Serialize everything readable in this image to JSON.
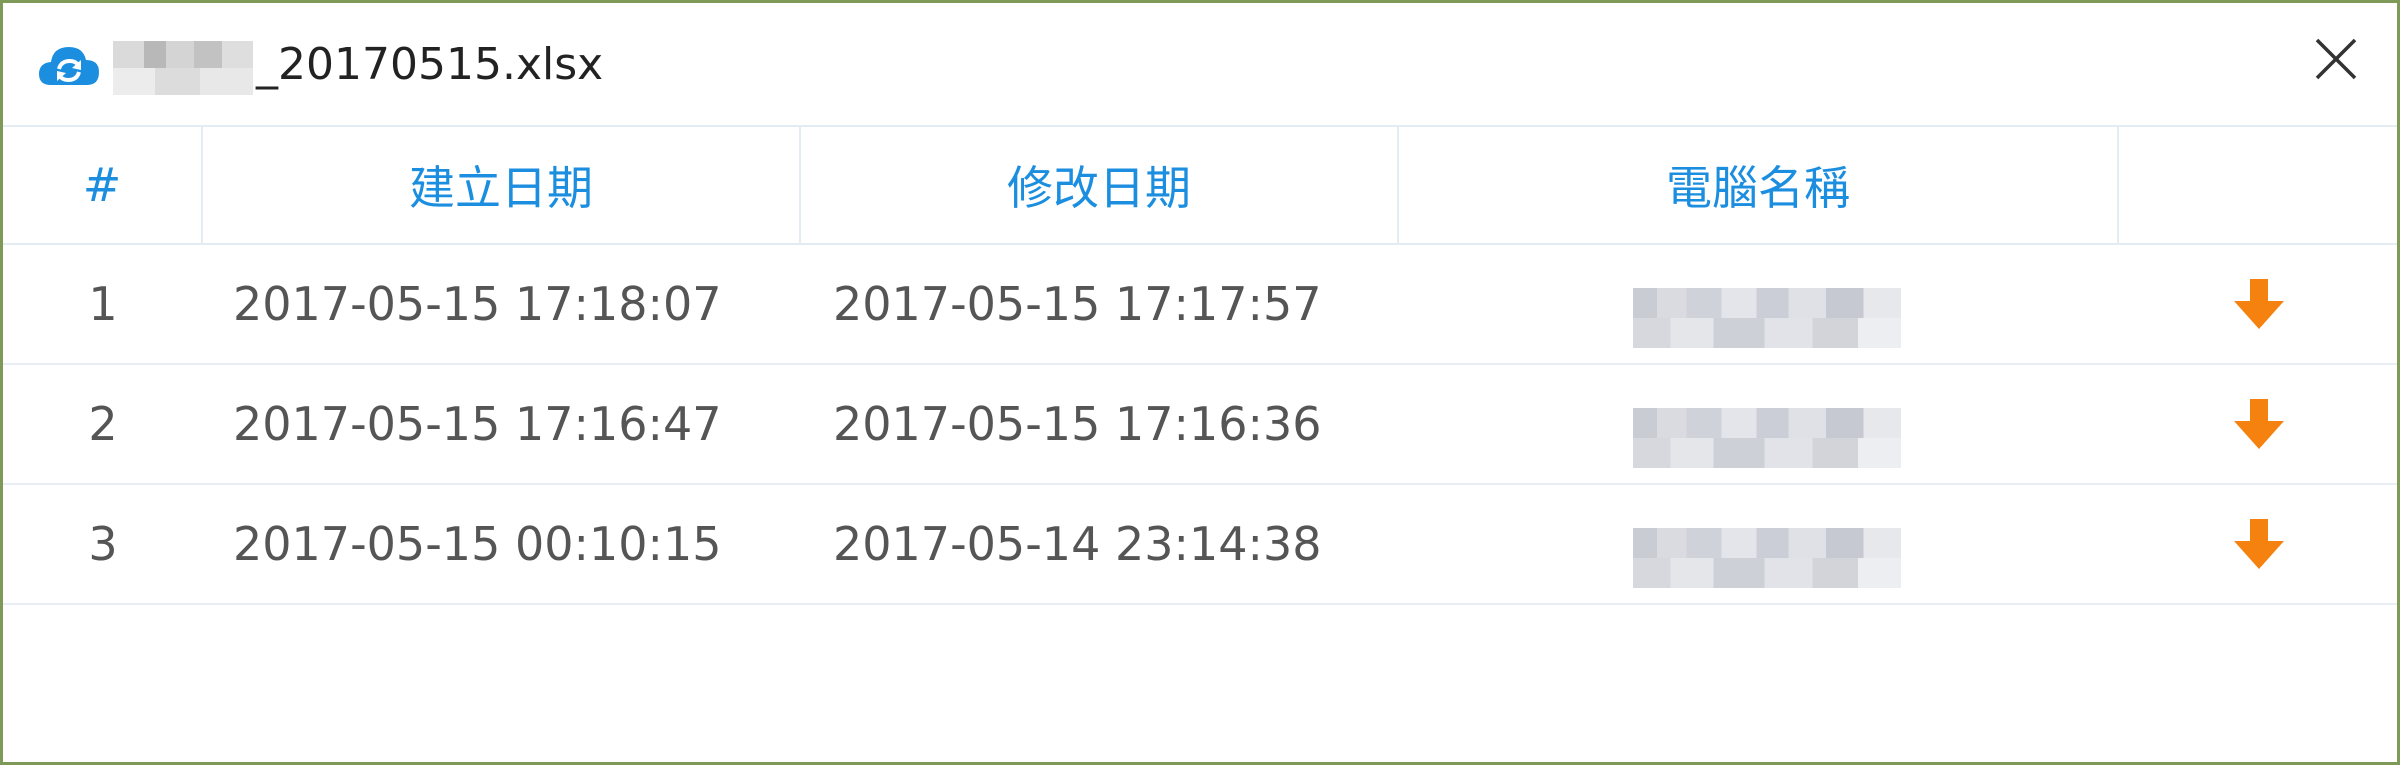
{
  "window": {
    "title": "_20170515.xlsx",
    "icon": "cloud-sync-icon",
    "close_icon": "close-icon",
    "accent": "#1c8ee0",
    "download_color": "#f5820f"
  },
  "table": {
    "headers": {
      "num": "#",
      "created": "建立日期",
      "modified": "修改日期",
      "computer": "電腦名稱",
      "action": ""
    },
    "rows": [
      {
        "num": "1",
        "created": "2017-05-15 17:18:07",
        "modified": "2017-05-15 17:17:57",
        "action_icon": "download-arrow-icon"
      },
      {
        "num": "2",
        "created": "2017-05-15 17:16:47",
        "modified": "2017-05-15 17:16:36",
        "action_icon": "download-arrow-icon"
      },
      {
        "num": "3",
        "created": "2017-05-15 00:10:15",
        "modified": "2017-05-14 23:14:38",
        "action_icon": "download-arrow-icon"
      }
    ]
  }
}
